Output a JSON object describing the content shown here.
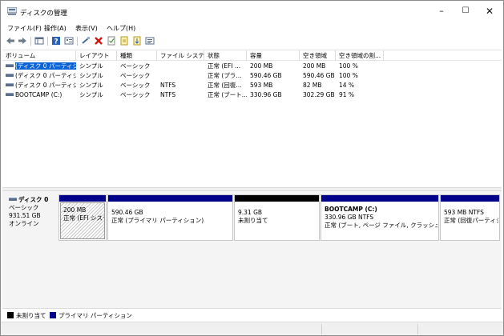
{
  "window": {
    "title": "ディスクの管理"
  },
  "menu": [
    "ファイル(F)",
    "操作(A)",
    "表示(V)",
    "ヘルプ(H)"
  ],
  "colors": {
    "primary_partition": "#00008b",
    "unallocated": "#000000",
    "selection": "#0a64d8"
  },
  "toolbar_icons": [
    "back-arrow-icon",
    "forward-arrow-icon",
    "console-tree-icon",
    "help-icon",
    "properties-icon",
    "connect-disk-icon",
    "delete-icon",
    "check-icon",
    "export-icon",
    "import-icon",
    "list-icon"
  ],
  "table": {
    "columns": [
      "ボリューム",
      "レイアウト",
      "種類",
      "ファイル システム",
      "状態",
      "容量",
      "空き領域",
      "空き領域の割..."
    ],
    "rows": [
      [
        "(ディスク 0 パーティシ...",
        "シンプル",
        "ベーシック",
        "",
        "正常 (EFI ...",
        "200 MB",
        "200 MB",
        "100 %"
      ],
      [
        "(ディスク 0 パーティシ...",
        "シンプル",
        "ベーシック",
        "",
        "正常 (プラ...",
        "590.46 GB",
        "590.46 GB",
        "100 %"
      ],
      [
        "(ディスク 0 パーティシ...",
        "シンプル",
        "ベーシック",
        "NTFS",
        "正常 (回復...",
        "593 MB",
        "82 MB",
        "14 %"
      ],
      [
        "BOOTCAMP (C:)",
        "シンプル",
        "ベーシック",
        "NTFS",
        "正常 (ブート...",
        "330.96 GB",
        "302.29 GB",
        "91 %"
      ]
    ]
  },
  "disk": {
    "name": "ディスク 0",
    "type": "ベーシック",
    "size": "931.51 GB",
    "status": "オンライン"
  },
  "partitions": [
    {
      "name": "",
      "size": "200 MB",
      "status": "正常 (EFI システ"
    },
    {
      "name": "",
      "size": "590.46 GB",
      "status": "正常 (プライマリ パーティション)"
    },
    {
      "name": "",
      "size": "9.31 GB",
      "status": "未割り当て"
    },
    {
      "name": "BOOTCAMP (C:)",
      "size": "330.96 GB NTFS",
      "status": "正常 (ブート, ページ ファイル, クラッシュ ダンプ"
    },
    {
      "name": "",
      "size": "593 MB NTFS",
      "status": "正常 (回復パーティシ"
    }
  ],
  "legend": [
    {
      "label": "未割り当て",
      "color": "#000000"
    },
    {
      "label": "プライマリ パーティション",
      "color": "#00008b"
    }
  ]
}
